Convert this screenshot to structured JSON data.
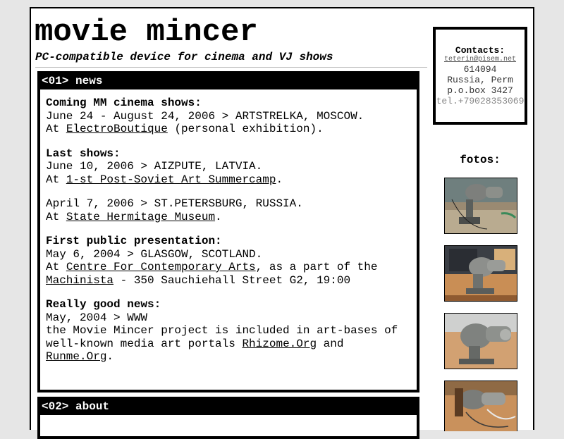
{
  "site": {
    "title": "movie mincer",
    "tagline": "PC-compatible device for cinema and VJ shows"
  },
  "sections": [
    {
      "header": "<01> news",
      "items": [
        {
          "title": "Coming MM cinema shows:",
          "lines": [
            "June 24 - August 24, 2006 > ARTSTRELKA, MOSCOW."
          ],
          "at_prefix": "At ",
          "link": "ElectroBoutique",
          "after_link": " (personal exhibition)."
        },
        {
          "title": "Last shows:",
          "lines": [
            "June 10, 2006 > AIZPUTE, LATVIA."
          ],
          "at_prefix": "At ",
          "link": "1-st Post-Soviet Art Summercamp",
          "after_link": "."
        },
        {
          "title": "",
          "lines": [
            "April 7, 2006 > ST.PETERSBURG, RUSSIA."
          ],
          "at_prefix": "At ",
          "link": "State Hermitage Museum",
          "after_link": "."
        },
        {
          "title": "First public presentation:",
          "lines": [
            "May 6, 2004 > GLASGOW, SCOTLAND."
          ],
          "at_prefix": "At ",
          "link": "Centre For Contemporary Arts",
          "after_link": ", as a part of the",
          "link2": "Machinista",
          "after_link2": " - 350 Sauchiehall Street G2, 19:00"
        },
        {
          "title": "Really good news:",
          "lines": [
            "May, 2004 > WWW",
            "the Movie Mincer project is included in art-bases of"
          ],
          "prefix3": "well-known media art portals ",
          "link": "Rhizome.Org",
          "after_link": " and",
          "link2": "Runme.Org",
          "after_link2": "."
        }
      ]
    },
    {
      "header": "<02> about"
    }
  ],
  "contacts": {
    "heading": "Contacts:",
    "email": "teterin@pisem.net",
    "postcode": "614094",
    "city": "Russia, Perm",
    "pobox": "p.o.box 3427",
    "phone": "tel.+79028353069"
  },
  "fotos": {
    "heading": "fotos:",
    "photos": [
      {
        "name": "meat mincer on desk with cable"
      },
      {
        "name": "meat mincer in front of monitor"
      },
      {
        "name": "meat mincer close-up"
      },
      {
        "name": "meat mincer with wires"
      }
    ]
  }
}
